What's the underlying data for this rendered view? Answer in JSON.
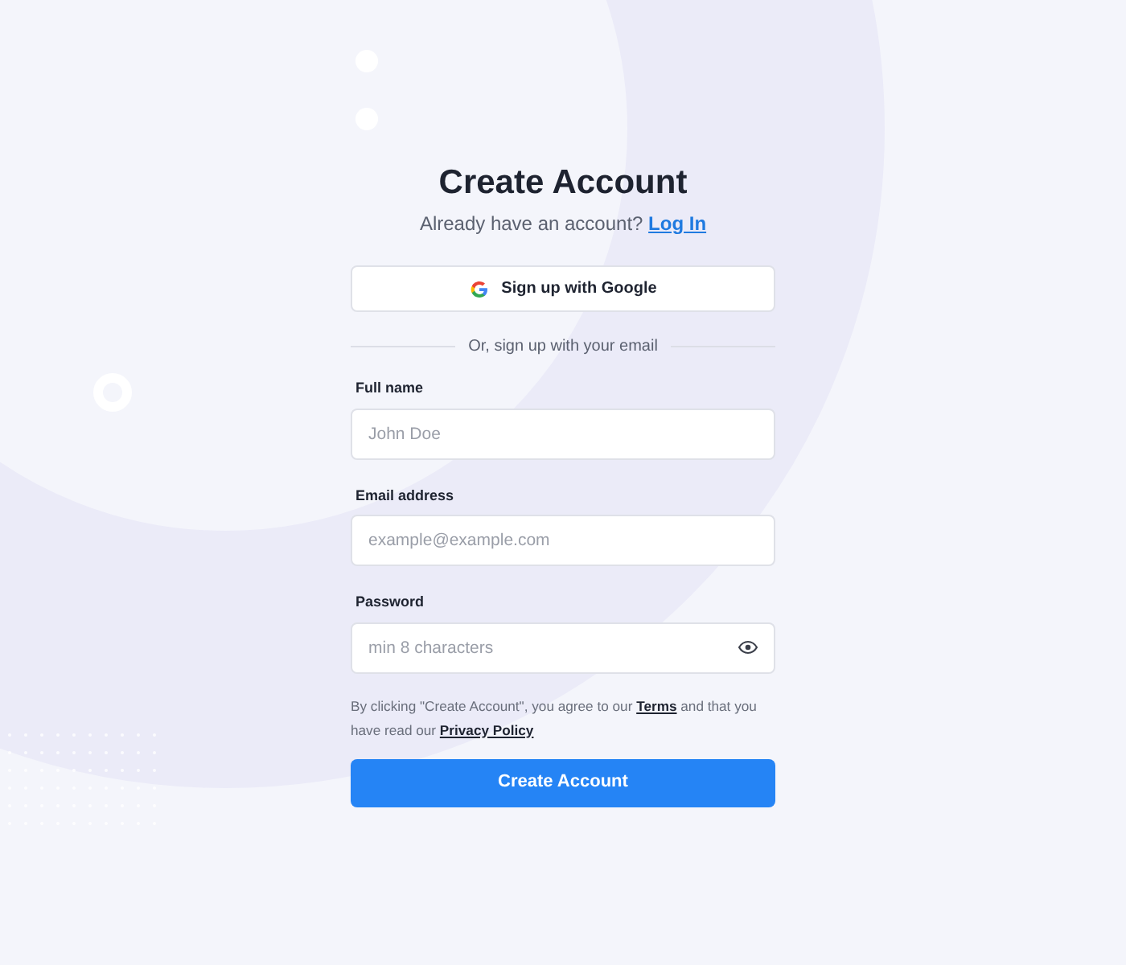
{
  "title": "Create Account",
  "subtitle": {
    "text": "Already have an account?",
    "link": "Log In"
  },
  "google_button": {
    "label": "Sign up with Google"
  },
  "divider": "Or, sign up with your email",
  "fields": [
    {
      "kind": "text",
      "label": "Full name",
      "placeholder": "John Doe"
    },
    {
      "kind": "email",
      "label": "Email address",
      "placeholder": "example@example.com"
    },
    {
      "kind": "password",
      "label": "Password",
      "placeholder": "min 8 characters"
    }
  ],
  "terms": [
    {
      "kind": "text",
      "text": "By clicking \"Create Account\", you agree to our "
    },
    {
      "kind": "link",
      "text": "Terms"
    },
    {
      "kind": "text",
      "text": " and that you have read our "
    },
    {
      "kind": "link",
      "text": "Privacy Policy"
    }
  ],
  "submit": {
    "label": "Create Account"
  }
}
